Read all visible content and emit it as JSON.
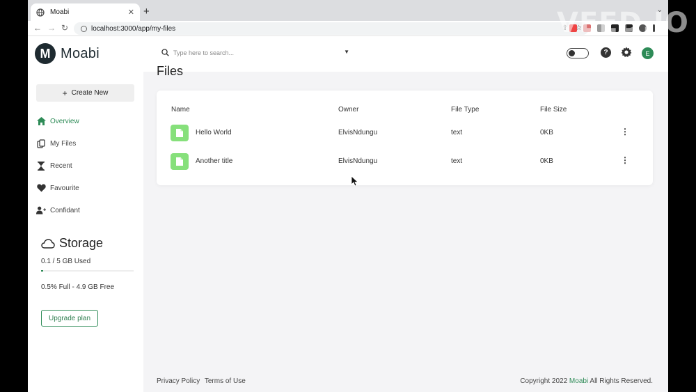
{
  "browser": {
    "tab_title": "Moabi",
    "url": "localhost:3000/app/my-files"
  },
  "brand": {
    "letter": "M",
    "name": "Moabi",
    "accent": "#2e8b57"
  },
  "sidebar": {
    "create_label": "Create New",
    "items": [
      {
        "label": "Overview",
        "icon": "home-icon",
        "active": true
      },
      {
        "label": "My Files",
        "icon": "files-icon"
      },
      {
        "label": "Recent",
        "icon": "hourglass-icon"
      },
      {
        "label": "Favourite",
        "icon": "heart-icon"
      },
      {
        "label": "Confidant",
        "icon": "user-plus-icon"
      }
    ],
    "storage": {
      "title": "Storage",
      "used_text": "0.1 / 5 GB Used",
      "percent_full": 0.5,
      "free_text": "0.5% Full - 4.9 GB Free",
      "upgrade_label": "Upgrade plan"
    }
  },
  "topbar": {
    "search_placeholder": "Type here to search...",
    "avatar_letter": "E"
  },
  "page": {
    "title": "Files"
  },
  "table": {
    "headers": [
      "Name",
      "Owner",
      "File Type",
      "File Size"
    ],
    "rows": [
      {
        "name": "Hello World",
        "owner": "ElvisNdungu",
        "type": "text",
        "size": "0KB"
      },
      {
        "name": "Another title",
        "owner": "ElvisNdungu",
        "type": "text",
        "size": "0KB"
      }
    ]
  },
  "footer": {
    "privacy": "Privacy Policy",
    "terms": "Terms of Use",
    "copyright_pre": "Copyright 2022",
    "copyright_brand": "Moabi",
    "copyright_post": "All Rights Reserved."
  },
  "watermark": "VEED.IO"
}
